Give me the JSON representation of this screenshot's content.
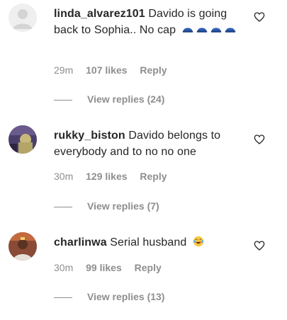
{
  "comments": [
    {
      "username": "linda_alvarez101",
      "text": "Davido is going back to Sophia.. No cap",
      "emoji_name": "blue-helmet-emoji",
      "emoji_count": 4,
      "time": "29m",
      "likes": "107 likes",
      "reply_label": "Reply",
      "view_replies": "View replies (24)",
      "avatar_color": "#e5e5e5"
    },
    {
      "username": "rukky_biston",
      "text": "Davido belongs to everybody and to no no one",
      "time": "30m",
      "likes": "129 likes",
      "reply_label": "Reply",
      "view_replies": "View replies (7)",
      "avatar_color": "#3b2f5a"
    },
    {
      "username": "charlinwa",
      "text": "Serial husband",
      "emoji_name": "tears-of-joy-emoji",
      "emoji_count": 1,
      "time": "30m",
      "likes": "99 likes",
      "reply_label": "Reply",
      "view_replies": "View replies (13)",
      "avatar_color": "#7a3b2a"
    }
  ],
  "icons": {
    "heart": "heart-outline-icon"
  },
  "colors": {
    "text": "#262626",
    "muted": "#8e8e8e",
    "emoji_blue": "#2f5fb5",
    "emoji_yellow": "#f7c843"
  }
}
